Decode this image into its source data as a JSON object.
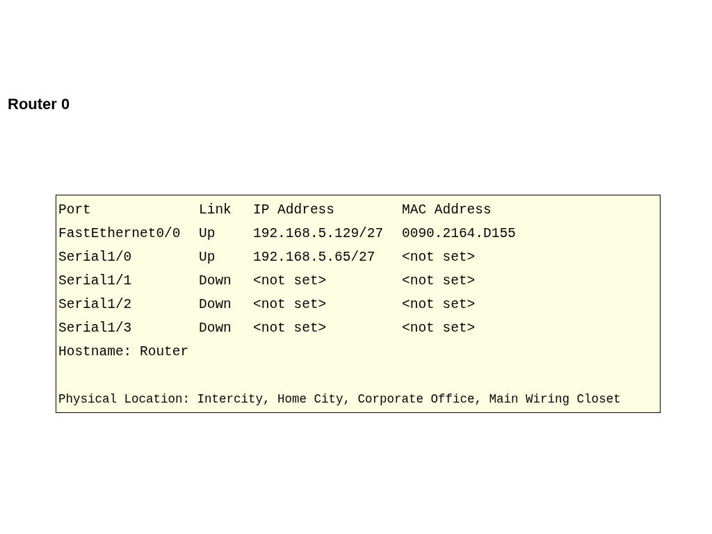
{
  "title": "Router 0",
  "table": {
    "columns": [
      "Port",
      "Link",
      "IP Address",
      "MAC Address"
    ],
    "rows": [
      {
        "port": "FastEthernet0/0",
        "link": "Up",
        "ip": "192.168.5.129/27",
        "mac": "0090.2164.D155"
      },
      {
        "port": "Serial1/0",
        "link": "Up",
        "ip": "192.168.5.65/27",
        "mac": "<not set>"
      },
      {
        "port": "Serial1/1",
        "link": "Down",
        "ip": "<not set>",
        "mac": "<not set>"
      },
      {
        "port": "Serial1/2",
        "link": "Down",
        "ip": "<not set>",
        "mac": "<not set>"
      },
      {
        "port": "Serial1/3",
        "link": "Down",
        "ip": "<not set>",
        "mac": "<not set>"
      }
    ]
  },
  "hostname": "Hostname: Router",
  "location": "Physical Location: Intercity, Home City, Corporate Office, Main Wiring Closet"
}
